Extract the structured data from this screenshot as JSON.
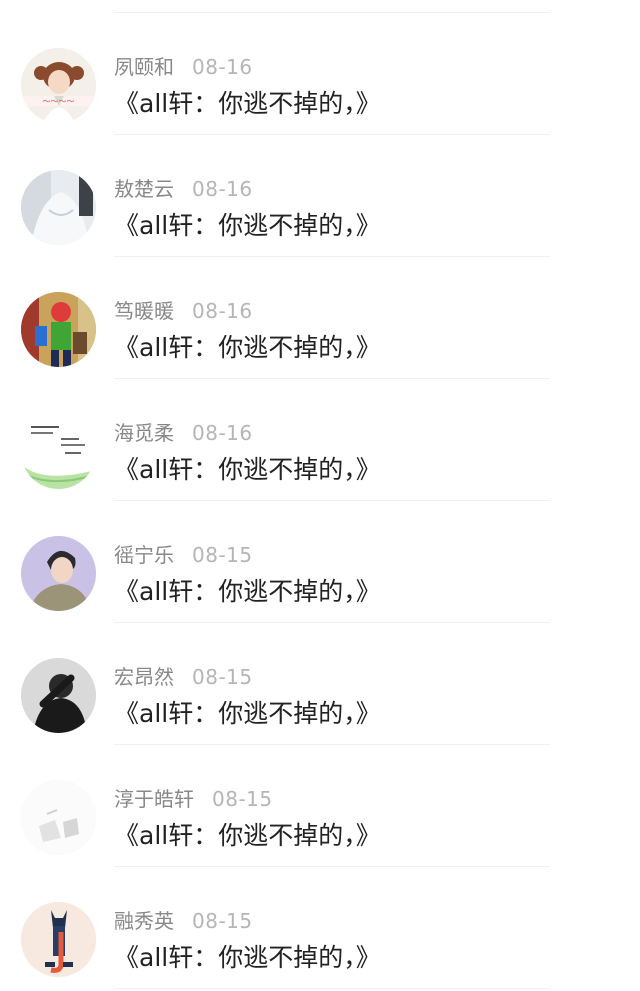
{
  "comments": [
    {
      "name": "夙颐和",
      "date": "08-16",
      "text": "《all轩：你逃不掉的，》",
      "avatar": "avatar-girl-pigtails"
    },
    {
      "name": "敖楚云",
      "date": "08-16",
      "text": "《all轩：你逃不掉的，》",
      "avatar": "avatar-white-clothes"
    },
    {
      "name": "笃暖暖",
      "date": "08-16",
      "text": "《all轩：你逃不掉的，》",
      "avatar": "avatar-colorful-cartoon"
    },
    {
      "name": "海觅柔",
      "date": "08-16",
      "text": "《all轩：你逃不掉的，》",
      "avatar": "avatar-text-note"
    },
    {
      "name": "徭宁乐",
      "date": "08-15",
      "text": "《all轩：你逃不掉的，》",
      "avatar": "avatar-boy-portrait"
    },
    {
      "name": "宏昂然",
      "date": "08-15",
      "text": "《all轩：你逃不掉的，》",
      "avatar": "avatar-dark-figure"
    },
    {
      "name": "淳于皓轩",
      "date": "08-15",
      "text": "《all轩：你逃不掉的，》",
      "avatar": "avatar-light-sketch"
    },
    {
      "name": "融秀英",
      "date": "08-15",
      "text": "《all轩：你逃不掉的，》",
      "avatar": "avatar-cartoon-figure"
    }
  ]
}
